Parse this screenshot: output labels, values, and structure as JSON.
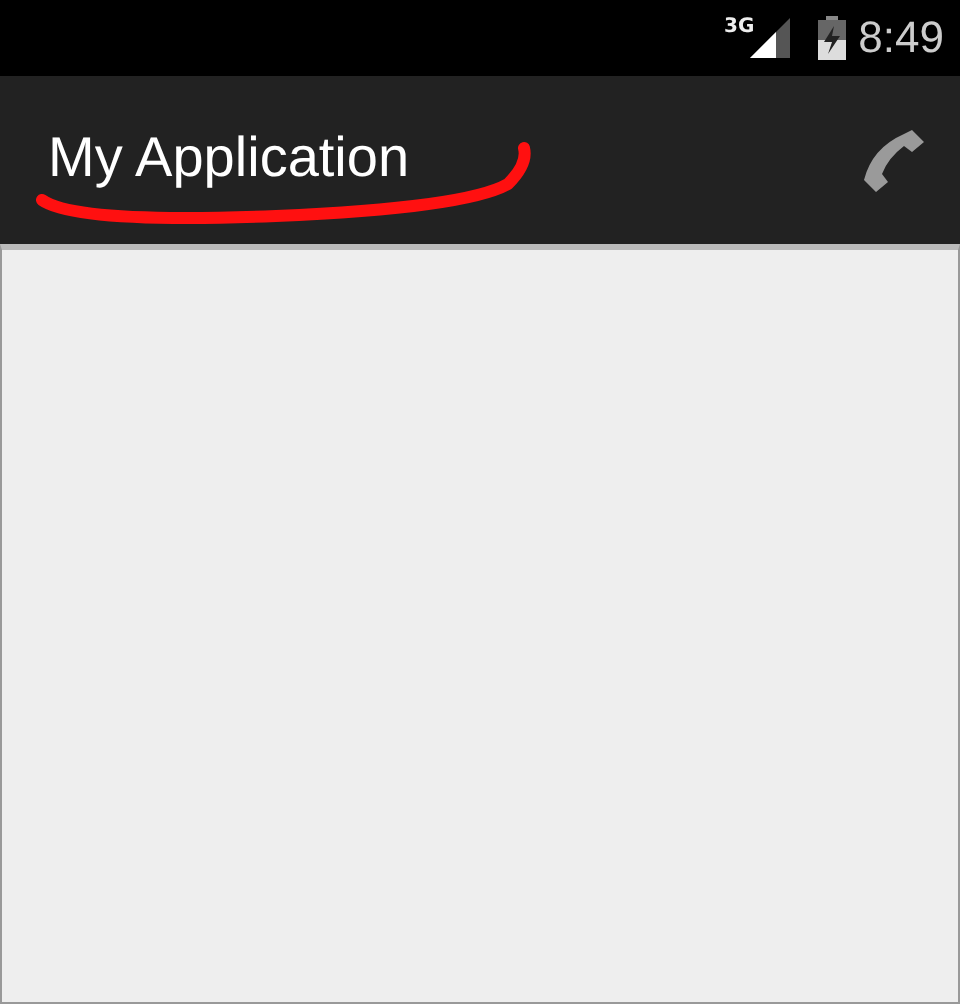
{
  "status_bar": {
    "network": "3G",
    "time": "8:49"
  },
  "action_bar": {
    "title": "My Application"
  }
}
